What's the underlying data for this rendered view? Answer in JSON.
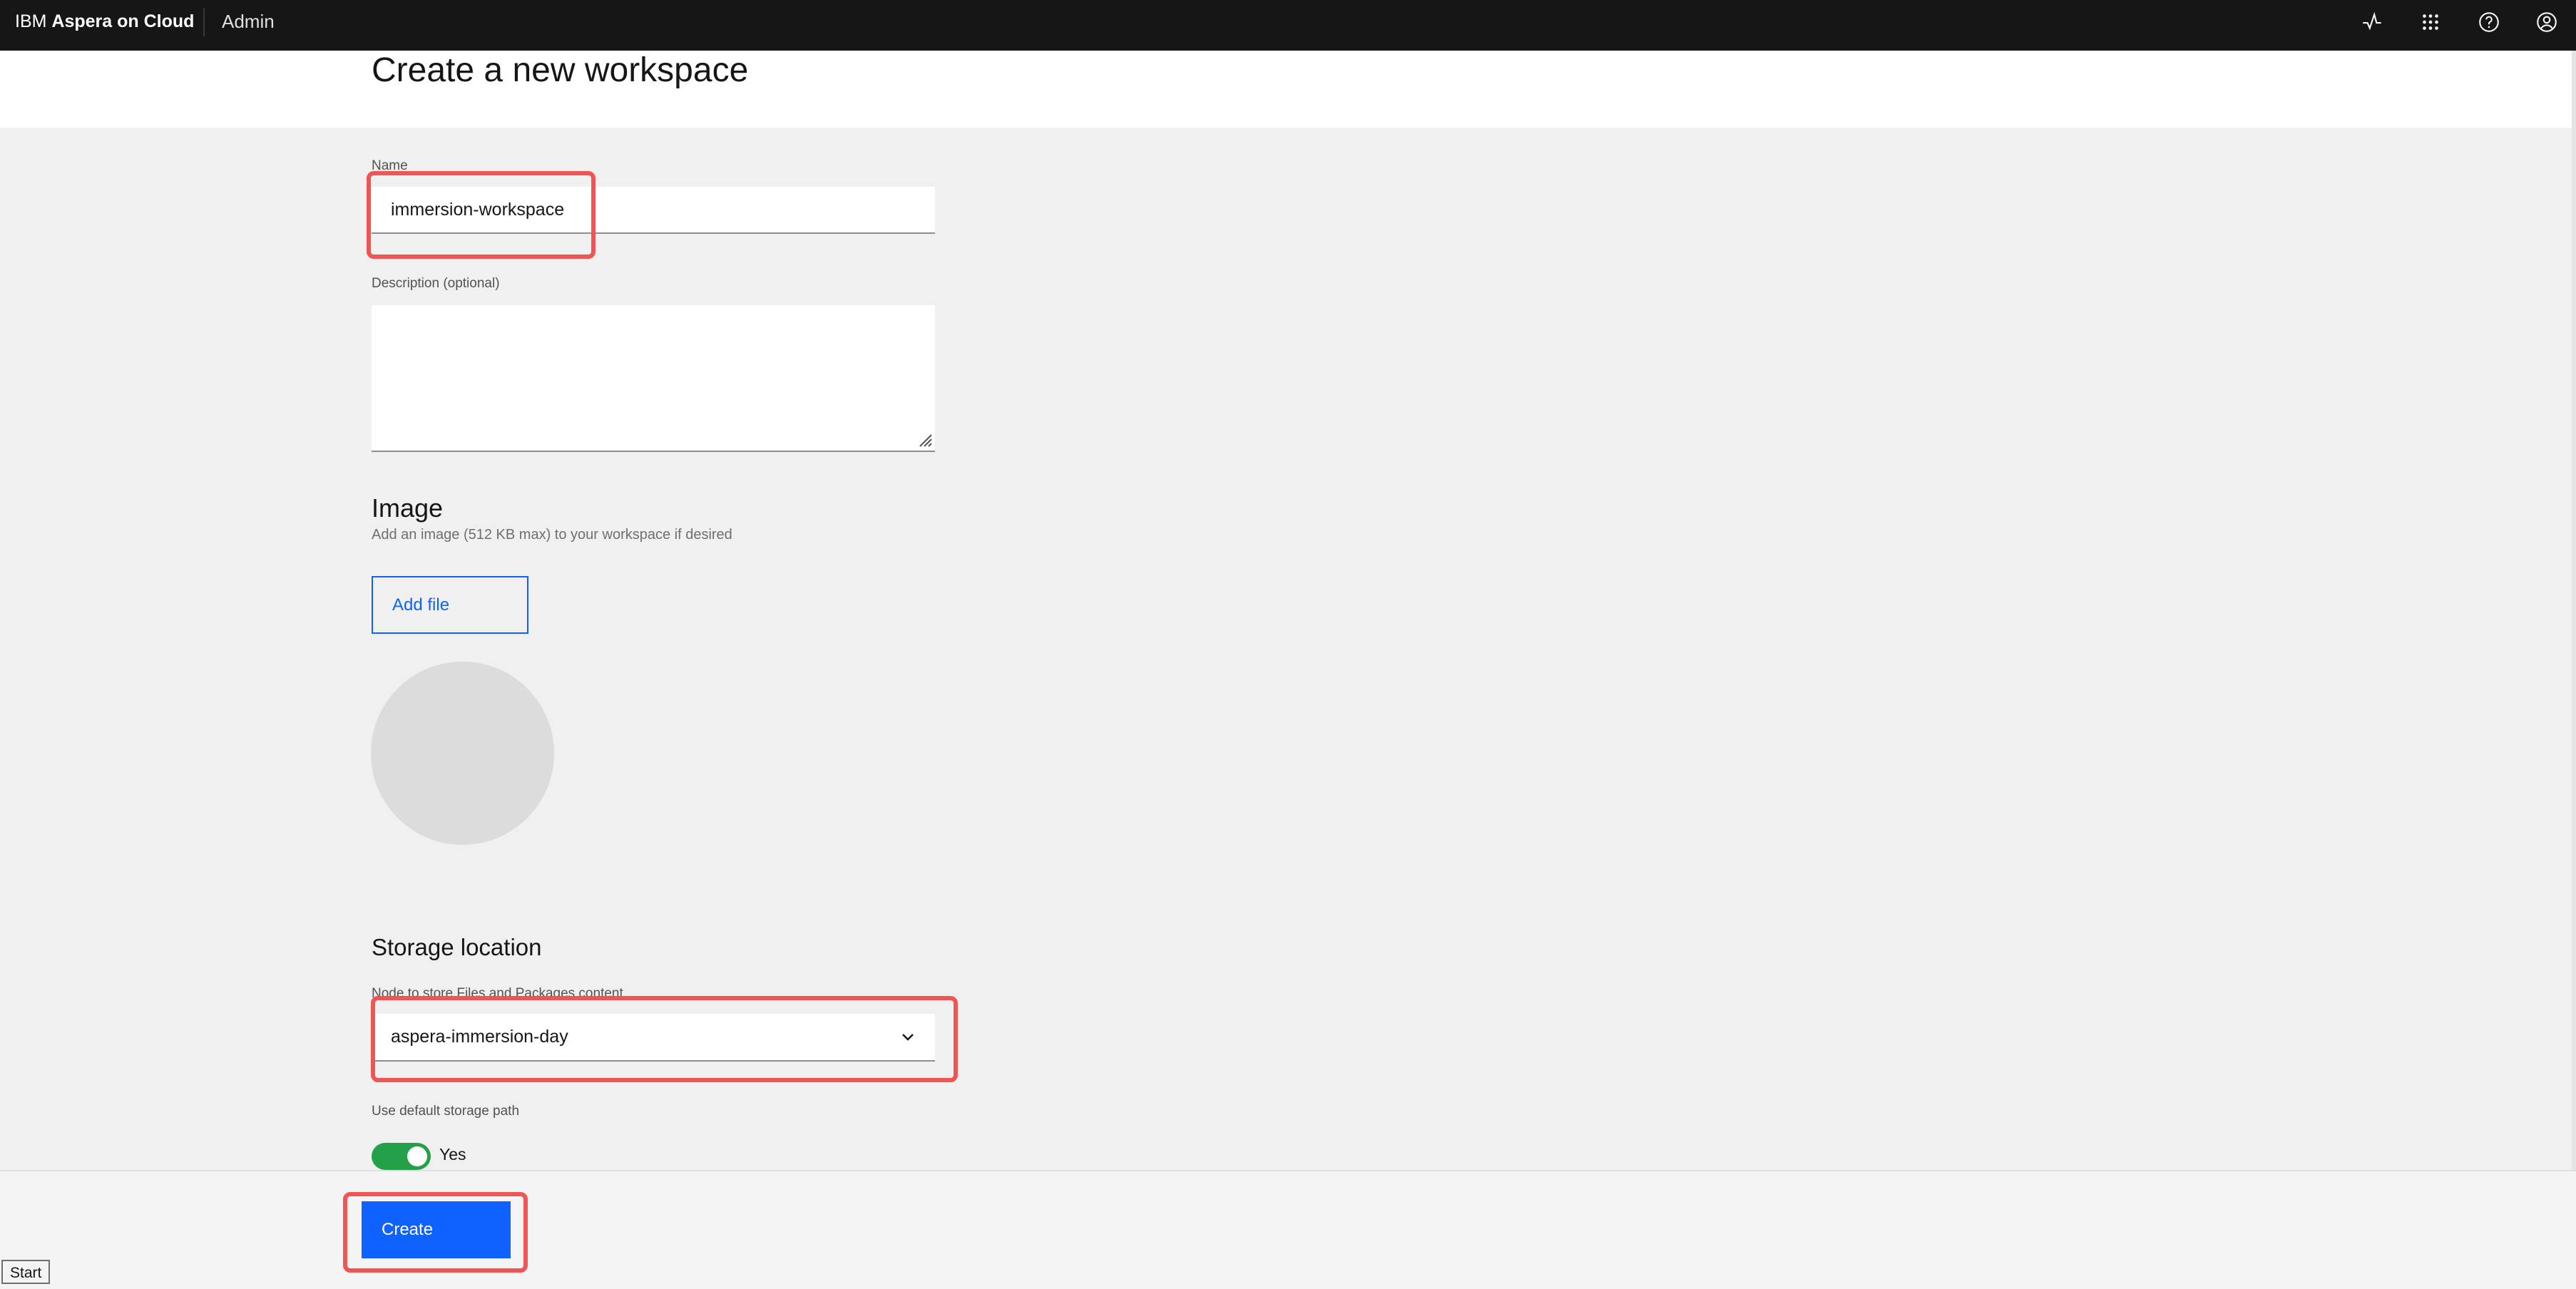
{
  "header": {
    "brand_prefix": "IBM ",
    "brand_name": "Aspera on Cloud",
    "admin_label": "Admin",
    "icons": [
      "activity-icon",
      "app-switcher-icon",
      "help-icon",
      "user-avatar-icon"
    ]
  },
  "page": {
    "title": "Create a new workspace"
  },
  "form": {
    "name": {
      "label": "Name",
      "value": "immersion-workspace"
    },
    "description": {
      "label": "Description (optional)",
      "value": ""
    },
    "image": {
      "heading": "Image",
      "helper": "Add an image (512 KB max) to your workspace if desired",
      "add_file_label": "Add file"
    },
    "storage": {
      "heading": "Storage location",
      "node_label": "Node to store Files and Packages content",
      "node_value": "aspera-immersion-day",
      "default_path_label": "Use default storage path",
      "default_path_state": "Yes",
      "default_path_on": true
    }
  },
  "footer": {
    "create_label": "Create"
  },
  "taskbar": {
    "start_label": "Start"
  },
  "colors": {
    "topbar": "#161616",
    "primary": "#0f62fe",
    "toggle_on": "#24a148",
    "annotation": "#f05454"
  }
}
